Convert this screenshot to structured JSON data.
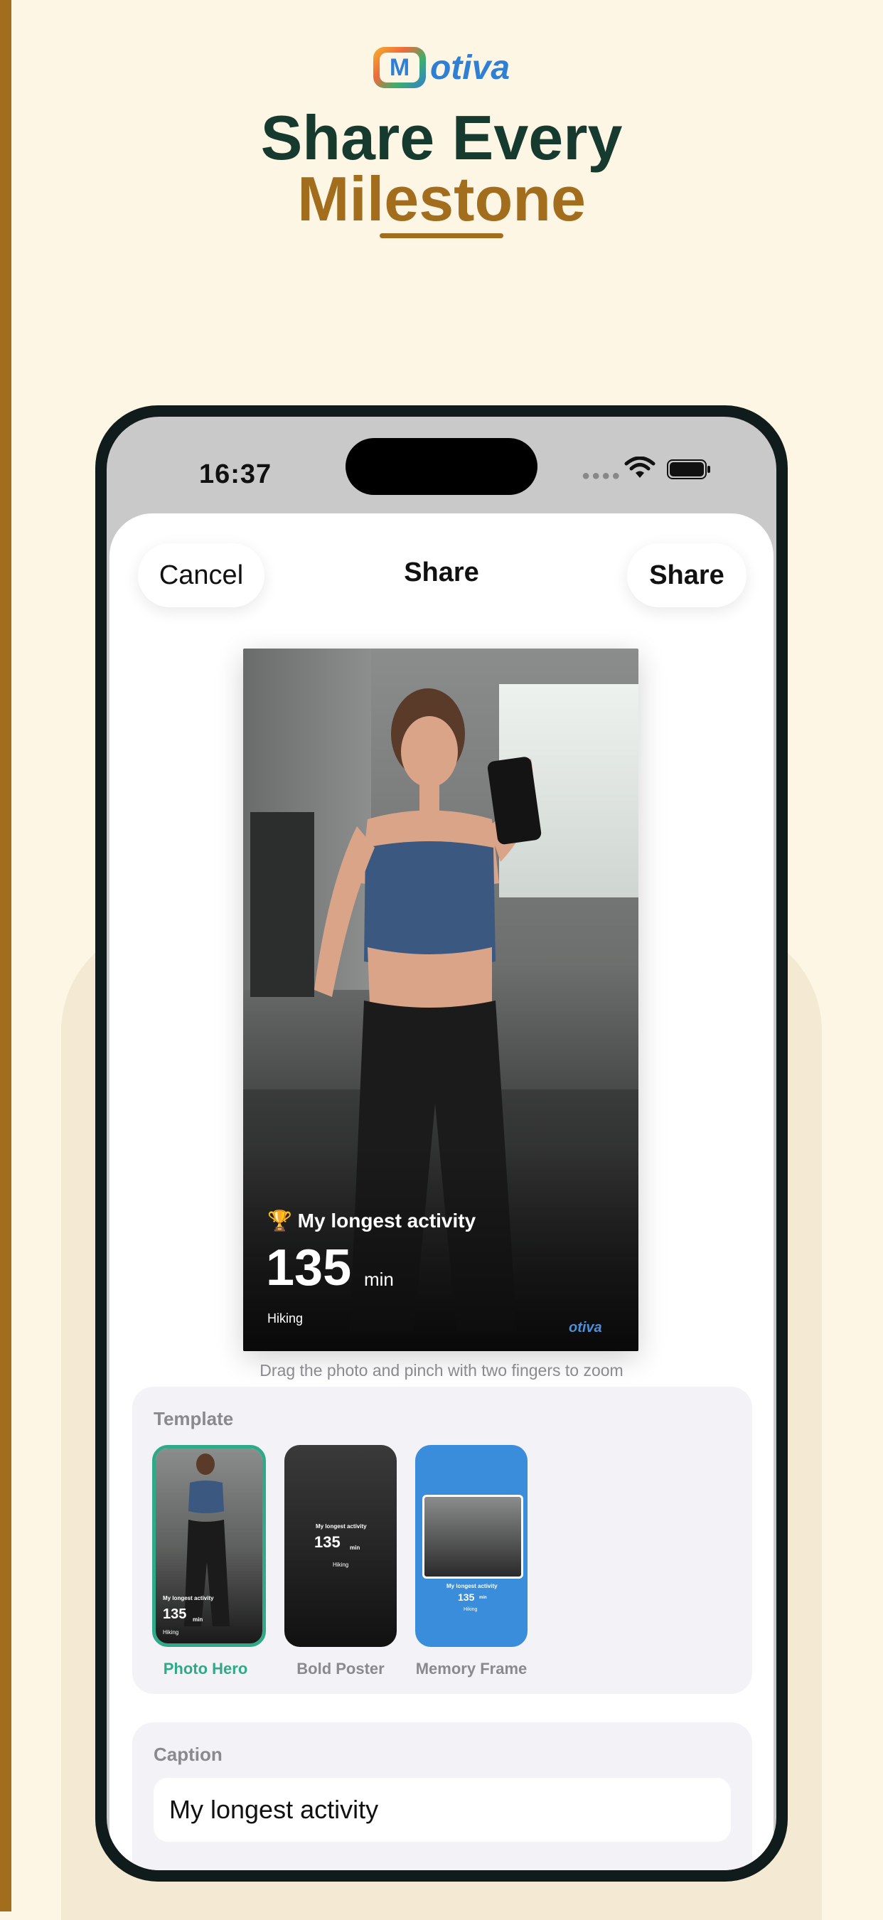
{
  "brand": {
    "name": "otiva",
    "logo_letter": "M"
  },
  "headline": {
    "line1": "Share Every",
    "line2": "Milestone"
  },
  "status_bar": {
    "time": "16:37"
  },
  "sheet": {
    "cancel_label": "Cancel",
    "title": "Share",
    "share_label": "Share"
  },
  "preview": {
    "trophy": "🏆",
    "headline": "My longest activity",
    "value": "135",
    "unit": "min",
    "activity": "Hiking",
    "brand": "otiva"
  },
  "hint": "Drag the photo and pinch with two fingers to zoom",
  "template_section": {
    "label": "Template",
    "items": [
      {
        "label": "Photo Hero",
        "selected": true
      },
      {
        "label": "Bold Poster",
        "selected": false
      },
      {
        "label": "Memory Frame",
        "selected": false
      }
    ]
  },
  "caption_section": {
    "label": "Caption",
    "value": "My longest activity"
  },
  "colors": {
    "accent_green": "#2fa987",
    "brand_gold": "#a26e1e",
    "headline_dark": "#163a2e",
    "frame_blue": "#3a8ddb"
  }
}
